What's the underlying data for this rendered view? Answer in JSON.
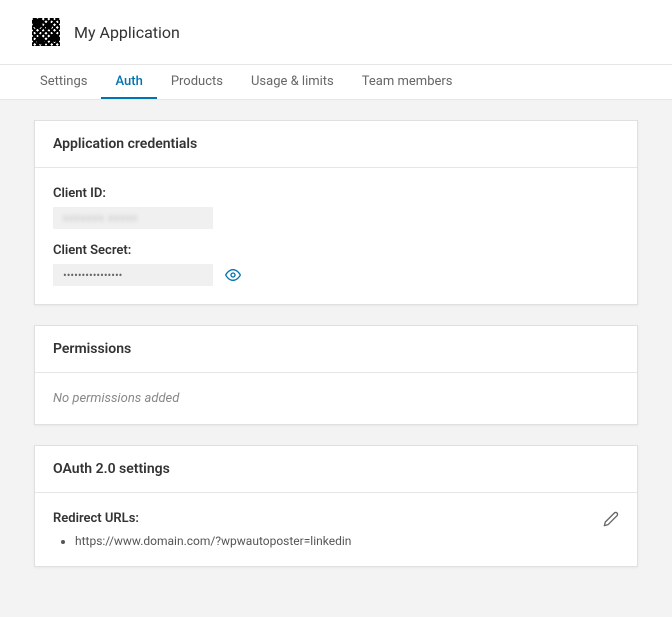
{
  "header": {
    "app_title": "My Application"
  },
  "tabs": {
    "items": [
      {
        "label": "Settings"
      },
      {
        "label": "Auth"
      },
      {
        "label": "Products"
      },
      {
        "label": "Usage & limits"
      },
      {
        "label": "Team members"
      }
    ]
  },
  "credentials": {
    "title": "Application credentials",
    "client_id_label": "Client ID:",
    "client_id_value": "xxxxxxx xxxxx",
    "client_secret_label": "Client Secret:",
    "client_secret_value": "••••••••••••••••"
  },
  "permissions": {
    "title": "Permissions",
    "empty_text": "No permissions added"
  },
  "oauth": {
    "title": "OAuth 2.0 settings",
    "redirect_label": "Redirect URLs:",
    "redirect_urls": [
      "https://www.domain.com/?wpwautoposter=linkedin"
    ]
  }
}
